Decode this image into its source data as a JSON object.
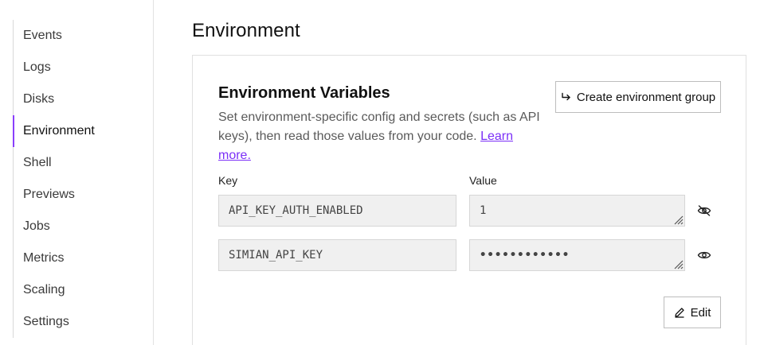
{
  "sidebar": {
    "items": [
      {
        "label": "Events"
      },
      {
        "label": "Logs"
      },
      {
        "label": "Disks"
      },
      {
        "label": "Environment",
        "active": true
      },
      {
        "label": "Shell"
      },
      {
        "label": "Previews"
      },
      {
        "label": "Jobs"
      },
      {
        "label": "Metrics"
      },
      {
        "label": "Scaling"
      },
      {
        "label": "Settings"
      }
    ]
  },
  "page": {
    "title": "Environment"
  },
  "env_vars": {
    "title": "Environment Variables",
    "description": "Set environment-specific config and secrets (such as API keys), then read those values from your code.",
    "learn_more": "Learn more.",
    "create_group_label": "Create environment group",
    "key_header": "Key",
    "value_header": "Value",
    "rows": [
      {
        "key": "API_KEY_AUTH_ENABLED",
        "value": "1",
        "visibility_icon": "eye-slash-icon"
      },
      {
        "key": "SIMIAN_API_KEY",
        "value": "••••••••••••",
        "visibility_icon": "eye-icon"
      }
    ],
    "edit_label": "Edit"
  },
  "colors": {
    "accent": "#8a3ffc",
    "link": "#7b2ff7",
    "field_bg": "#f0f0f0"
  }
}
